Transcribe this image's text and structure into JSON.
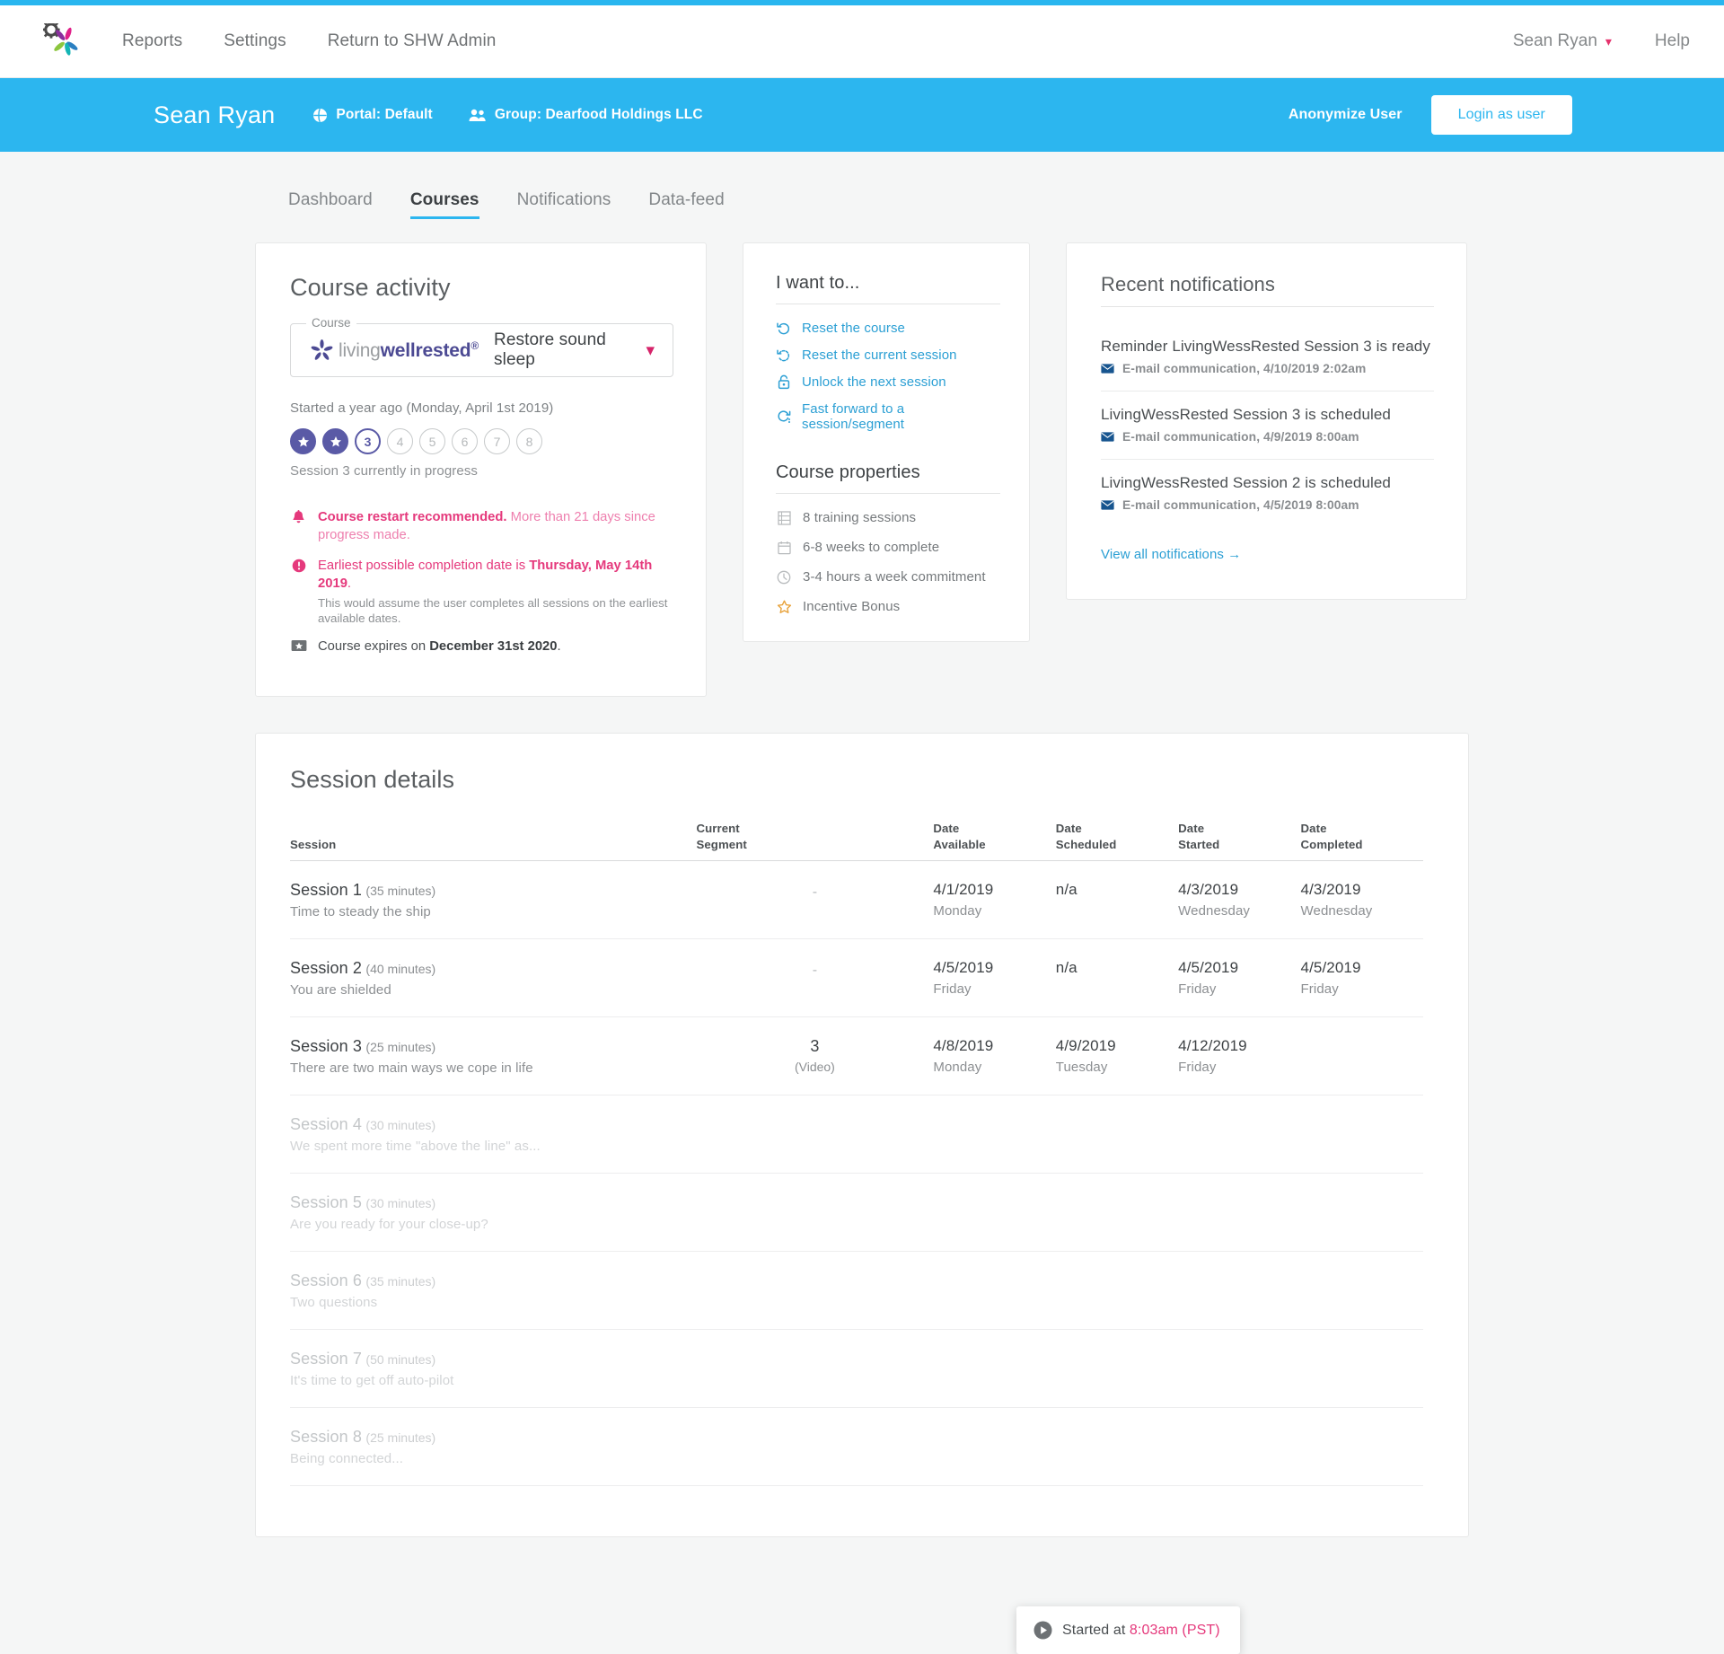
{
  "colors": {
    "accent_blue": "#2cb6ef",
    "link_blue": "#2b9fd4",
    "pink": "#e5397c",
    "purple": "#5a5aa6",
    "brand_purple": "#4c4a93",
    "orange": "#e8a33d",
    "page_bg": "#f5f6f6"
  },
  "topnav": {
    "logo_name": "shw-pinwheel-logo",
    "links": [
      {
        "label": "Reports"
      },
      {
        "label": "Settings"
      },
      {
        "label": "Return to SHW Admin"
      }
    ],
    "user_menu": "Sean Ryan",
    "help": "Help"
  },
  "subheader": {
    "user_name": "Sean Ryan",
    "portal": "Portal: Default",
    "group": "Group: Dearfood Holdings LLC",
    "anonymize": "Anonymize User",
    "login_as_user": "Login as user"
  },
  "tabs": [
    {
      "label": "Dashboard",
      "active": false
    },
    {
      "label": "Courses",
      "active": true
    },
    {
      "label": "Notifications",
      "active": false
    },
    {
      "label": "Data-feed",
      "active": false
    }
  ],
  "course_activity": {
    "title": "Course activity",
    "field_legend": "Course",
    "brand_living": "living",
    "brand_wellrested": "wellrested",
    "brand_reg": "®",
    "selected_course": "Restore sound sleep",
    "started_text": "Started a year ago (Monday, April 1st 2019)",
    "dots": [
      {
        "label": "1",
        "state": "done"
      },
      {
        "label": "2",
        "state": "done"
      },
      {
        "label": "3",
        "state": "current"
      },
      {
        "label": "4",
        "state": "future"
      },
      {
        "label": "5",
        "state": "future"
      },
      {
        "label": "6",
        "state": "future"
      },
      {
        "label": "7",
        "state": "future"
      },
      {
        "label": "8",
        "state": "future"
      }
    ],
    "dots_caption": "Session 3 currently in progress",
    "alerts": {
      "restart_bold": "Course restart recommended.",
      "restart_rest": " More than 21 days since progress made.",
      "earliest_prefix": "Earliest possible completion date is ",
      "earliest_bold": "Thursday, May 14th 2019",
      "earliest_suffix": ".",
      "earliest_note": "This would assume the user completes all sessions on the earliest available dates.",
      "expires_prefix": "Course expires on ",
      "expires_bold": "December 31st 2020",
      "expires_suffix": "."
    }
  },
  "i_want_to": {
    "title": "I want to...",
    "items": [
      {
        "label": "Reset the course",
        "icon": "undo-icon"
      },
      {
        "label": "Reset the current session",
        "icon": "refresh-dotted-icon"
      },
      {
        "label": "Unlock the next session",
        "icon": "lock-icon"
      },
      {
        "label": "Fast forward to a session/segment",
        "icon": "fast-forward-icon"
      }
    ]
  },
  "course_properties": {
    "title": "Course properties",
    "items": [
      {
        "label": "8 training sessions",
        "icon": "film-icon"
      },
      {
        "label": "6-8 weeks to complete",
        "icon": "calendar-icon"
      },
      {
        "label": "3-4 hours a week commitment",
        "icon": "clock-icon"
      },
      {
        "label": "Incentive Bonus",
        "icon": "star-icon"
      }
    ]
  },
  "recent_notifications": {
    "title": "Recent notifications",
    "items": [
      {
        "title": "Reminder LivingWessRested Session 3 is ready",
        "meta": "E-mail communication, 4/10/2019 2:02am"
      },
      {
        "title": "LivingWessRested Session 3 is scheduled",
        "meta": "E-mail communication, 4/9/2019 8:00am"
      },
      {
        "title": "LivingWessRested Session 2 is scheduled",
        "meta": "E-mail communication, 4/5/2019 8:00am"
      }
    ],
    "view_all": "View all notifications →"
  },
  "session_details": {
    "title": "Session details",
    "columns": [
      {
        "line1": "Session",
        "line2": ""
      },
      {
        "line1": "Current",
        "line2": "Segment"
      },
      {
        "line1": "Date",
        "line2": "Available"
      },
      {
        "line1": "Date",
        "line2": "Scheduled"
      },
      {
        "line1": "Date",
        "line2": "Started"
      },
      {
        "line1": "Date",
        "line2": "Completed"
      }
    ],
    "rows": [
      {
        "name": "Session 1",
        "duration": "(35 minutes)",
        "desc": "Time to steady the ship",
        "segment": "-",
        "segment_sub": "",
        "locked": false,
        "available": "4/1/2019",
        "available_day": "Monday",
        "scheduled": "n/a",
        "scheduled_day": "",
        "started": "4/3/2019",
        "started_day": "Wednesday",
        "completed": "4/3/2019",
        "completed_day": "Wednesday"
      },
      {
        "name": "Session 2",
        "duration": "(40 minutes)",
        "desc": "You are shielded",
        "segment": "-",
        "segment_sub": "",
        "locked": false,
        "available": "4/5/2019",
        "available_day": "Friday",
        "scheduled": "n/a",
        "scheduled_day": "",
        "started": "4/5/2019",
        "started_day": "Friday",
        "completed": "4/5/2019",
        "completed_day": "Friday"
      },
      {
        "name": "Session 3",
        "duration": "(25 minutes)",
        "desc": "There are two main ways we cope in life",
        "segment": "3",
        "segment_sub": "(Video)",
        "locked": false,
        "available": "4/8/2019",
        "available_day": "Monday",
        "scheduled": "4/9/2019",
        "scheduled_day": "Tuesday",
        "started": "4/12/2019",
        "started_day": "Friday",
        "completed": "",
        "completed_day": ""
      },
      {
        "name": "Session 4",
        "duration": "(30 minutes)",
        "desc": "We spent more time \"above the line\" as...",
        "segment": "",
        "segment_sub": "",
        "locked": true,
        "available": "",
        "available_day": "",
        "scheduled": "",
        "scheduled_day": "",
        "started": "",
        "started_day": "",
        "completed": "",
        "completed_day": ""
      },
      {
        "name": "Session 5",
        "duration": "(30 minutes)",
        "desc": "Are you ready for your close-up?",
        "segment": "",
        "segment_sub": "",
        "locked": true,
        "available": "",
        "available_day": "",
        "scheduled": "",
        "scheduled_day": "",
        "started": "",
        "started_day": "",
        "completed": "",
        "completed_day": ""
      },
      {
        "name": "Session 6",
        "duration": "(35 minutes)",
        "desc": "Two questions",
        "segment": "",
        "segment_sub": "",
        "locked": true,
        "available": "",
        "available_day": "",
        "scheduled": "",
        "scheduled_day": "",
        "started": "",
        "started_day": "",
        "completed": "",
        "completed_day": ""
      },
      {
        "name": "Session 7",
        "duration": "(50 minutes)",
        "desc": "It's time to get off auto-pilot",
        "segment": "",
        "segment_sub": "",
        "locked": true,
        "available": "",
        "available_day": "",
        "scheduled": "",
        "scheduled_day": "",
        "started": "",
        "started_day": "",
        "completed": "",
        "completed_day": ""
      },
      {
        "name": "Session 8",
        "duration": "(25 minutes)",
        "desc": "Being connected...",
        "segment": "",
        "segment_sub": "",
        "locked": true,
        "available": "",
        "available_day": "",
        "scheduled": "",
        "scheduled_day": "",
        "started": "",
        "started_day": "",
        "completed": "",
        "completed_day": ""
      }
    ],
    "tooltip": {
      "prefix": "Started at ",
      "time": "8:03am (PST)"
    }
  }
}
